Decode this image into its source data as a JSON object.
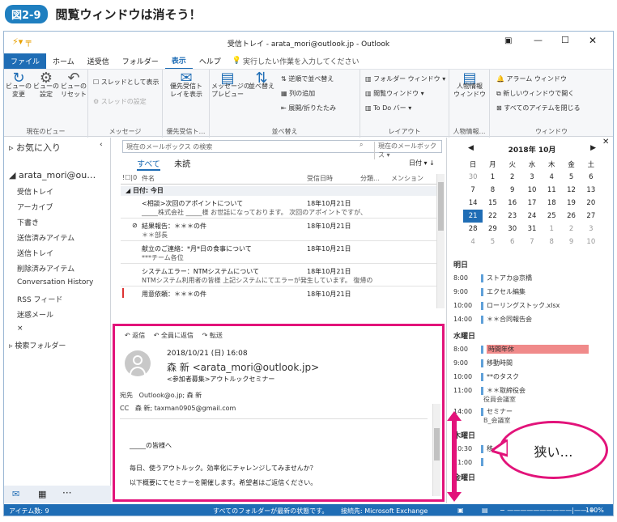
{
  "caption": {
    "badge": "図2-9",
    "title": "閲覧ウィンドウは消そう！"
  },
  "window": {
    "title": "受信トレイ - arata_mori@outlook.jp - Outlook"
  },
  "menu": [
    "ファイル",
    "ホーム",
    "送受信",
    "フォルダー",
    "表示",
    "ヘルプ"
  ],
  "tell_me": "実行したい作業を入力してください",
  "ribbon": {
    "view_group": {
      "change": "ビューの\n変更",
      "settings": "ビューの\n設定",
      "reset": "ビューの\nリセット",
      "label": "現在のビュー"
    },
    "msg_group": {
      "thread": "スレッドとして表示",
      "thread_settings": "スレッドの設定",
      "label": "メッセージ"
    },
    "priority_group": {
      "btn": "優先受信ト\nレイを表示",
      "label": "優先受信ト…"
    },
    "arrange_group": {
      "preview": "メッセージの\nプレビュー",
      "sort": "並べ替え",
      "reverse": "逆順で並べ替え",
      "add_col": "列の追加",
      "expand": "展開/折りたたみ",
      "label": "並べ替え"
    },
    "layout_group": {
      "folder": "フォルダー ウィンドウ",
      "reading": "閲覧ウィンドウ",
      "todo": "To Do バー",
      "label": "レイアウト"
    },
    "people_group": {
      "btn": "人物情報\nウィンドウ",
      "label": "人物情報…"
    },
    "window_group": {
      "reminder": "アラーム ウィンドウ",
      "new_window": "新しいウィンドウで開く",
      "close_all": "すべてのアイテムを閉じる",
      "label": "ウィンドウ"
    }
  },
  "nav": {
    "favorites": "お気に入り",
    "account": "arata_mori@ou…",
    "folders": [
      "受信トレイ",
      "アーカイブ",
      "下書き",
      "送信済みアイテム",
      "送信トレイ",
      "削除済みアイテム",
      "Conversation History",
      "RSS フィード",
      "迷惑メール",
      "×"
    ],
    "search_folders": "検索フォルダー"
  },
  "list": {
    "search_placeholder": "現在のメールボックス の検索",
    "scope": "現在のメールボックス",
    "tab_all": "すべて",
    "tab_unread": "未読",
    "sort": "日付",
    "col_subject": "件名",
    "col_received": "受信日時",
    "col_category": "分類…",
    "col_mention": "メンション",
    "group_today": "日付: 今日",
    "messages": [
      {
        "subject": "<相談>次回のアポイントについて",
        "date": "18年10月21日",
        "preview": "_____株式会社 _____様 お世話になっております。 次回のアポイントですが、"
      },
      {
        "subject": "結果報告：＊＊＊の件",
        "date": "18年10月21日",
        "preview": "＊＊部長"
      },
      {
        "subject": "献立のご連絡：*月*日の食事について",
        "date": "18年10月21日",
        "preview": "***チーム各位"
      },
      {
        "subject": "システムエラー：NTMシステムについて",
        "date": "18年10月21日",
        "preview": "NTMシステム利用者の皆様 上記システムにてエラーが発生しています。 復帰の"
      },
      {
        "subject": "用意依頼：＊＊＊の件",
        "date": "18年10月21日",
        "preview": ""
      }
    ]
  },
  "reading": {
    "reply": "返信",
    "reply_all": "全員に返信",
    "forward": "転送",
    "datetime": "2018/10/21 (日) 16:08",
    "from": "森 新 <arata_mori@outlook.jp>",
    "subject": "<参加者募集>アウトルックセミナー",
    "to_label": "宛先",
    "to": "Outlook@o.jp; 森 新",
    "cc_label": "CC",
    "cc": "森 新; taxman0905@gmail.com",
    "body1": "_____の皆様へ",
    "body2": "毎日、使うアウトルック。効率化にチャレンジしてみませんか？",
    "body3": "以下概要にてセミナーを開催します。希望者はご返信ください。"
  },
  "calendar": {
    "month": "2018年 10月",
    "weekdays": [
      "日",
      "月",
      "火",
      "水",
      "木",
      "金",
      "土"
    ],
    "weeks": [
      [
        "30",
        "1",
        "2",
        "3",
        "4",
        "5",
        "6"
      ],
      [
        "7",
        "8",
        "9",
        "10",
        "11",
        "12",
        "13"
      ],
      [
        "14",
        "15",
        "16",
        "17",
        "18",
        "19",
        "20"
      ],
      [
        "21",
        "22",
        "23",
        "24",
        "25",
        "26",
        "27"
      ],
      [
        "28",
        "29",
        "30",
        "31",
        "1",
        "2",
        "3"
      ],
      [
        "4",
        "5",
        "6",
        "7",
        "8",
        "9",
        "10"
      ]
    ]
  },
  "agenda": {
    "tomorrow": "明日",
    "tomorrow_items": [
      {
        "time": "8:00",
        "text": "ストアカ@京橋"
      },
      {
        "time": "9:00",
        "text": "エクセル編集"
      },
      {
        "time": "10:00",
        "text": "ローリングストック.xlsx"
      },
      {
        "time": "14:00",
        "text": "＊＊合同報告会"
      }
    ],
    "wednesday": "水曜日",
    "wed_items": [
      {
        "time": "8:00",
        "text": "時間年休",
        "highlight": true
      },
      {
        "time": "9:00",
        "text": "移動時間"
      },
      {
        "time": "10:00",
        "text": "**のタスク"
      },
      {
        "time": "11:00",
        "text": "＊＊取締役会",
        "sub": "役員会議室"
      },
      {
        "time": "14:00",
        "text": "セミナー",
        "sub": "B_会議室"
      }
    ],
    "thursday": "木曜日",
    "thu_items": [
      {
        "time": "10:30",
        "text": "移"
      },
      {
        "time": "11:00",
        "text": ""
      }
    ],
    "friday": "金曜日"
  },
  "status": {
    "items": "アイテム数: 9",
    "sync": "すべてのフォルダーが最新の状態です。",
    "connected": "接続先: Microsoft Exchange",
    "zoom": "100%"
  },
  "callout": "狭い…",
  "colors": {
    "accent": "#1f6db5",
    "highlight": "#e2137a"
  }
}
